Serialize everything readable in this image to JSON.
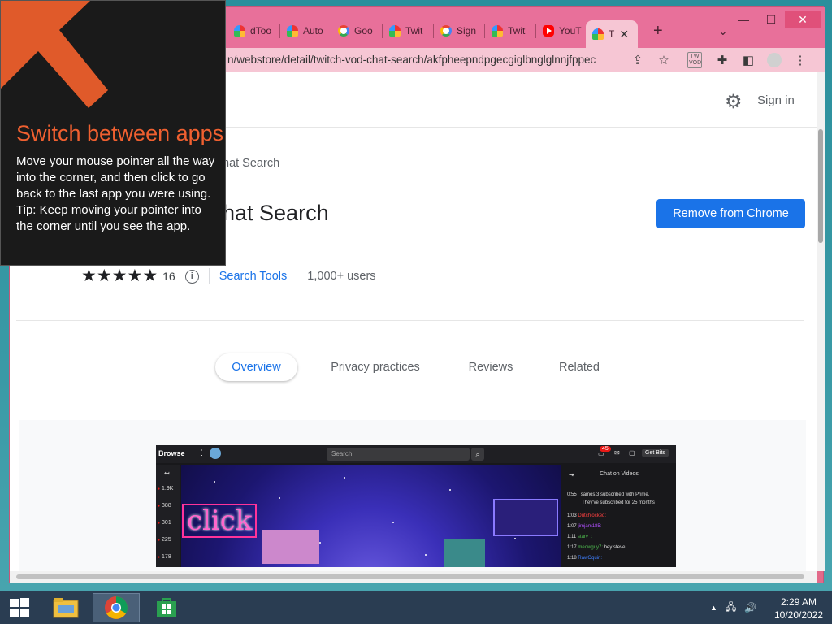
{
  "browser": {
    "tabs": [
      {
        "label": "dToo",
        "icon": "rainbow-favicon-icon"
      },
      {
        "label": "Auto",
        "icon": "rainbow-favicon-icon"
      },
      {
        "label": "Goo",
        "icon": "google-favicon-icon"
      },
      {
        "label": "Twit",
        "icon": "rainbow-favicon-icon"
      },
      {
        "label": "Sign",
        "icon": "google-favicon-icon"
      },
      {
        "label": "Twit",
        "icon": "rainbow-favicon-icon"
      },
      {
        "label": "YouT",
        "icon": "youtube-favicon-icon"
      },
      {
        "label": "T",
        "icon": "rainbow-favicon-icon",
        "active": true
      }
    ],
    "new_tab": "+",
    "tab_search": "⌄",
    "url": "n/webstore/detail/twitch-vod-chat-search/akfpheepndpgecgiglbnglglnnjfppec",
    "window_controls": {
      "minimize": "—",
      "maximize": "☐",
      "close": "✕"
    },
    "tw_badge": "TW\nVOD"
  },
  "store": {
    "sign_in": "Sign in",
    "breadcrumb": "hat Search",
    "title": "hat Search",
    "remove_button": "Remove from Chrome",
    "rating": 5,
    "rating_count": "16",
    "category": "Search Tools",
    "users": "1,000+ users",
    "tabs": [
      "Overview",
      "Privacy practices",
      "Reviews",
      "Related"
    ],
    "selected_tab": "Overview"
  },
  "screenshot": {
    "browse": "Browse",
    "search_placeholder": "Search",
    "notif_count": "45",
    "get_bits": "Get Bits",
    "chat_title": "Chat on Videos",
    "viewer_counts": [
      "1.9K",
      "388",
      "301",
      "225",
      "178"
    ],
    "overlay_word": "click",
    "chat_lines": [
      {
        "time": "0:55",
        "user": "",
        "text": "samos.3 subscribed with Prime."
      },
      {
        "time": "",
        "user": "",
        "text": "They've subscribed for 25 months"
      },
      {
        "time": "1:03",
        "user": "Dutchlocked:",
        "text": ""
      },
      {
        "time": "1:07",
        "user": "jimjam185:",
        "text": ""
      },
      {
        "time": "1:11",
        "user": "starv_:",
        "text": ""
      },
      {
        "time": "1:17",
        "user": "meowguy7:",
        "text": "hey steve"
      },
      {
        "time": "1:18",
        "user": "RawOquin:",
        "text": ""
      }
    ]
  },
  "tip": {
    "title": "Switch between apps",
    "body": "Move your mouse pointer all the way into the corner, and then click to go back to the last app you were using.",
    "tip": "Tip: Keep moving your pointer into the corner until you see the app."
  },
  "taskbar": {
    "time": "2:29 AM",
    "date": "10/20/2022"
  },
  "colors": {
    "accent": "#1a73e8",
    "tab_strip": "#e8709a",
    "tip_title": "#f06030",
    "taskbar": "#2a3d52"
  }
}
